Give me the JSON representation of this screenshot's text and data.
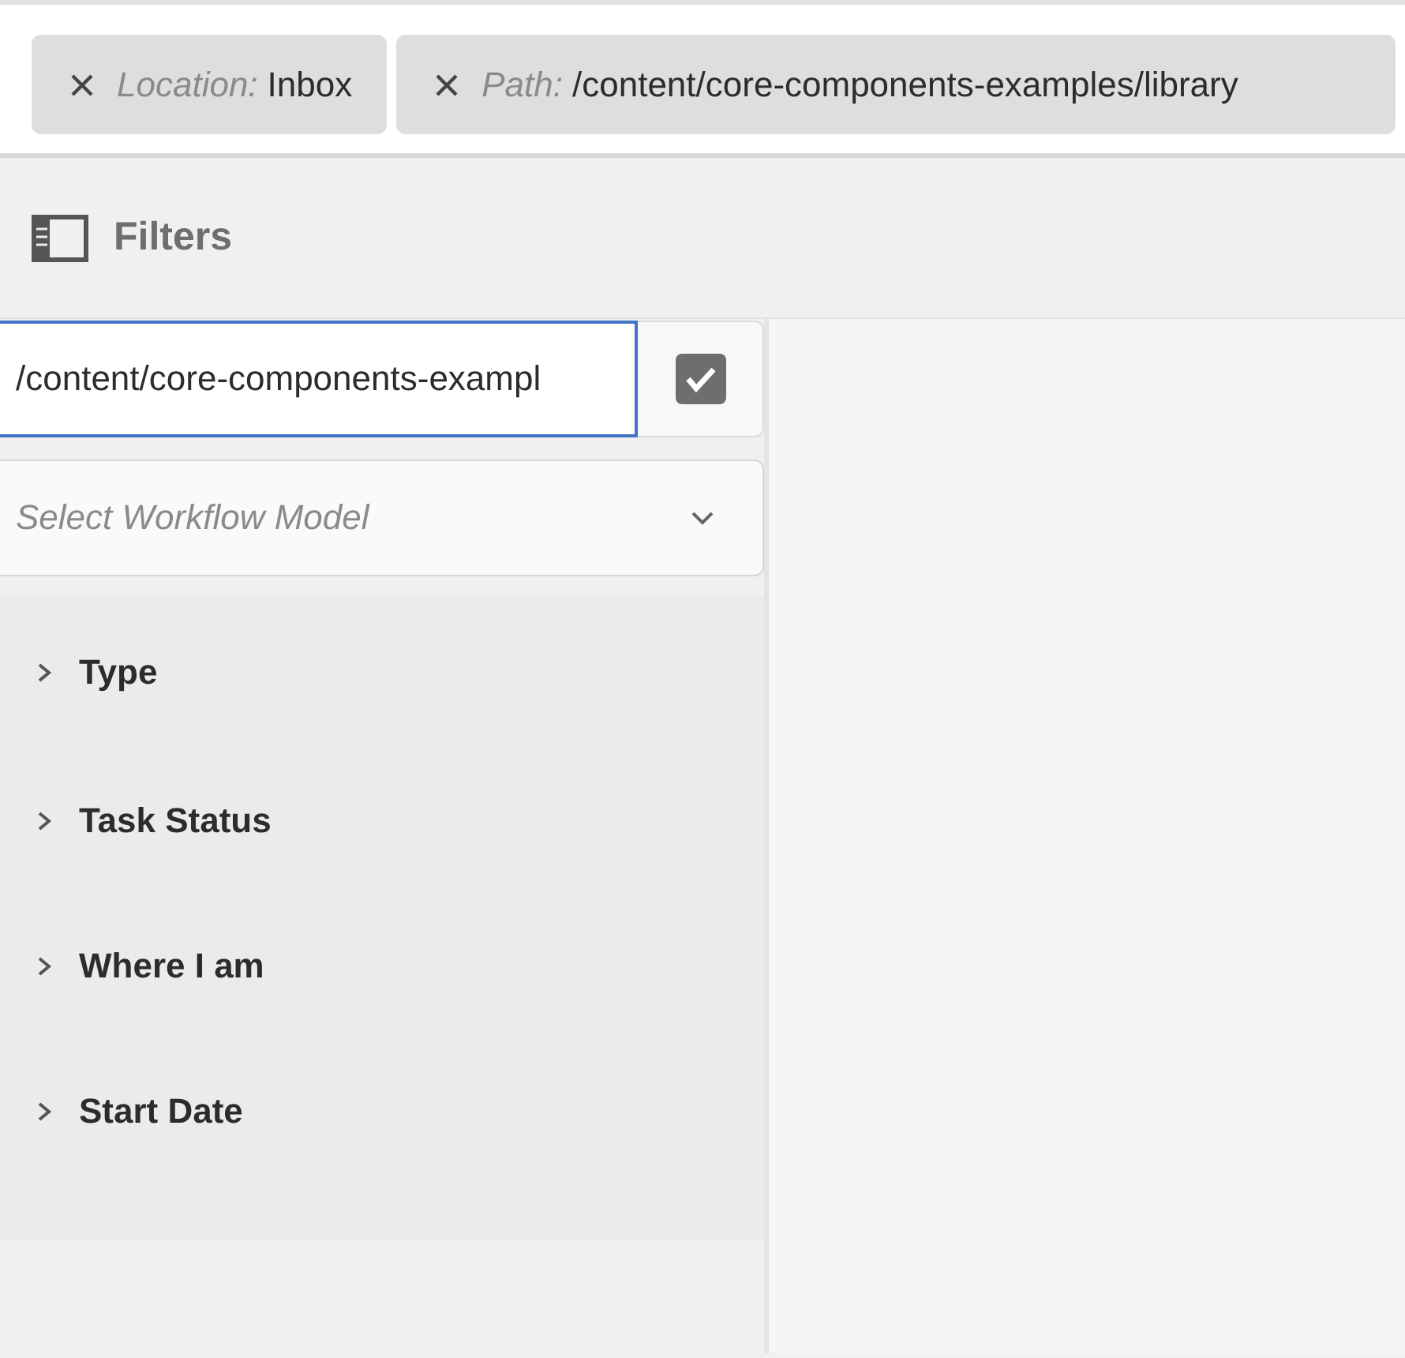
{
  "tags": [
    {
      "label": "Location:",
      "value": "Inbox"
    },
    {
      "label": "Path:",
      "value": "/content/core-components-examples/library"
    }
  ],
  "filters_panel": {
    "title": "Filters",
    "path_field": {
      "value": "/content/core-components-exampl",
      "checked": true
    },
    "model_select": {
      "placeholder": "Select Workflow Model"
    },
    "sections": [
      {
        "label": "Type",
        "expanded": false
      },
      {
        "label": "Task Status",
        "expanded": false
      },
      {
        "label": "Where I am",
        "expanded": false
      },
      {
        "label": "Start Date",
        "expanded": false
      }
    ]
  }
}
